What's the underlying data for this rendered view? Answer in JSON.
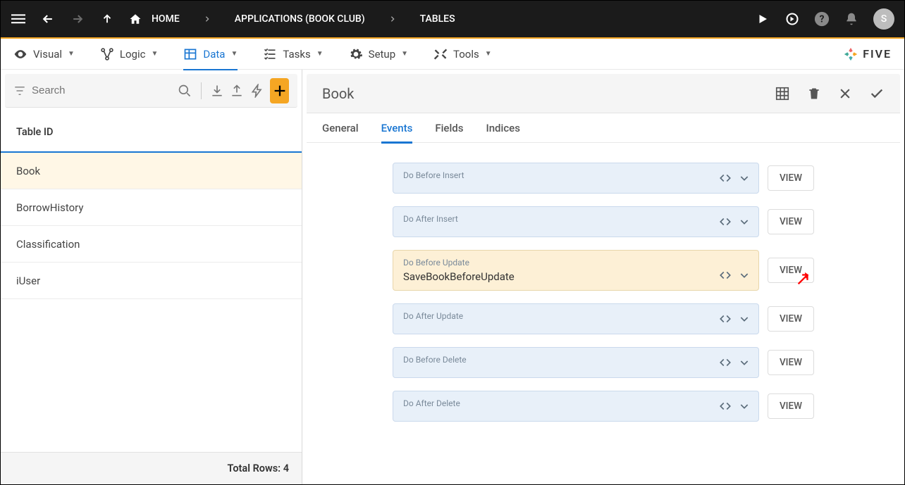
{
  "topbar": {
    "breadcrumbs": [
      {
        "label": "HOME",
        "has_home_icon": true
      },
      {
        "label": "APPLICATIONS (BOOK CLUB)"
      },
      {
        "label": "TABLES"
      }
    ],
    "avatar_initial": "S"
  },
  "secnav": {
    "items": [
      {
        "label": "Visual",
        "icon": "eye"
      },
      {
        "label": "Logic",
        "icon": "logic"
      },
      {
        "label": "Data",
        "icon": "table",
        "active": true
      },
      {
        "label": "Tasks",
        "icon": "tasks"
      },
      {
        "label": "Setup",
        "icon": "gear"
      },
      {
        "label": "Tools",
        "icon": "tools"
      }
    ],
    "brand": "FIVE"
  },
  "sidebar": {
    "search_placeholder": "Search",
    "column_header": "Table ID",
    "rows": [
      {
        "label": "Book",
        "selected": true
      },
      {
        "label": "BorrowHistory"
      },
      {
        "label": "Classification"
      },
      {
        "label": "iUser"
      }
    ],
    "footer": "Total Rows: 4"
  },
  "content": {
    "title": "Book",
    "tabs": [
      {
        "label": "General"
      },
      {
        "label": "Events",
        "active": true
      },
      {
        "label": "Fields"
      },
      {
        "label": "Indices"
      }
    ],
    "events": [
      {
        "label": "Do Before Insert",
        "value": "",
        "view": "VIEW"
      },
      {
        "label": "Do After Insert",
        "value": "",
        "view": "VIEW"
      },
      {
        "label": "Do Before Update",
        "value": "SaveBookBeforeUpdate",
        "view": "VIEW",
        "highlighted": true
      },
      {
        "label": "Do After Update",
        "value": "",
        "view": "VIEW"
      },
      {
        "label": "Do Before Delete",
        "value": "",
        "view": "VIEW"
      },
      {
        "label": "Do After Delete",
        "value": "",
        "view": "VIEW"
      }
    ]
  }
}
